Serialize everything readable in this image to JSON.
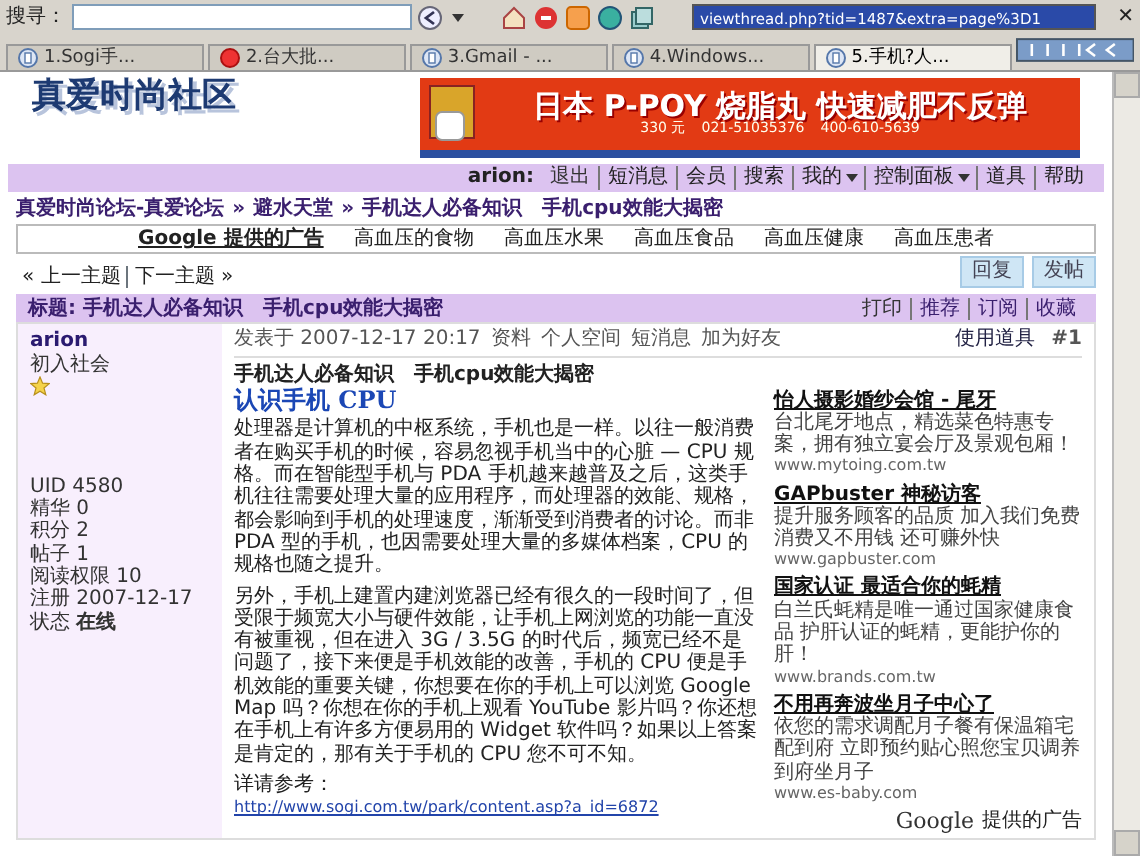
{
  "browser": {
    "search_label": "搜寻：",
    "address": "viewthread.php?tid=1487&extra=page%3D1",
    "close": "✕"
  },
  "tabs": [
    {
      "label": "1.Sogi手...",
      "selected": false,
      "kind": "page"
    },
    {
      "label": "2.台大批...",
      "selected": false,
      "kind": "error"
    },
    {
      "label": "3.Gmail - ...",
      "selected": false,
      "kind": "page"
    },
    {
      "label": "4.Windows...",
      "selected": false,
      "kind": "page"
    },
    {
      "label": "5.手机?人...",
      "selected": true,
      "kind": "page"
    }
  ],
  "site": {
    "logo": "真爱时尚社区",
    "banner": {
      "headline": "日本 P-POY 烧脂丸 快速减肥不反弹",
      "price": "330 元",
      "phones": [
        "021-51035376",
        "400-610-5639"
      ]
    }
  },
  "user_nav": {
    "user": "arion:",
    "links": [
      {
        "label": "退出",
        "dropdown": false
      },
      {
        "label": "短消息",
        "dropdown": false
      },
      {
        "label": "会员",
        "dropdown": false
      },
      {
        "label": "搜索",
        "dropdown": false
      },
      {
        "label": "我的",
        "dropdown": true
      },
      {
        "label": "控制面板",
        "dropdown": true
      },
      {
        "label": "道具",
        "dropdown": false
      },
      {
        "label": "帮助",
        "dropdown": false
      }
    ]
  },
  "breadcrumb": {
    "separator": "»",
    "items": [
      "真爱时尚论坛-真爱论坛",
      "避水天堂",
      "手机达人必备知识　手机cpu效能大揭密"
    ]
  },
  "ad_links": {
    "label": "Google 提供的广告",
    "links": [
      "高血压的食物",
      "高血压水果",
      "高血压食品",
      "高血压健康",
      "高血压患者"
    ]
  },
  "thread_nav": [
    "« 上一主题",
    "下一主题 »"
  ],
  "buttons": [
    "回复",
    "发帖"
  ],
  "thread_title": {
    "label": "标题:",
    "text": "手机达人必备知识　手机cpu效能大揭密"
  },
  "thread_actions": [
    "打印",
    "推荐",
    "订阅",
    "收藏"
  ],
  "post": {
    "author": {
      "name": "arion",
      "rank": "初入社会",
      "stats": [
        {
          "key": "UID",
          "value": "4580",
          "bold": false
        },
        {
          "key": "精华",
          "value": "0",
          "bold": false
        },
        {
          "key": "积分",
          "value": "2",
          "bold": false
        },
        {
          "key": "帖子",
          "value": "1",
          "bold": false
        },
        {
          "key": "阅读权限",
          "value": "10",
          "bold": false
        },
        {
          "key": "注册",
          "value": "2007-12-17",
          "bold": false
        },
        {
          "key": "状态",
          "value": "在线",
          "bold": true
        }
      ]
    },
    "meta": {
      "posted": "发表于 2007-12-17 20:17",
      "links": [
        "资料",
        "个人空间",
        "短消息",
        "加为好友"
      ],
      "tools": "使用道具",
      "floor": "#1"
    },
    "subtitle": "手机达人必备知识　手机cpu效能大揭密",
    "heading": "认识手机 CPU",
    "paragraphs": [
      "处理器是计算机的中枢系统，手机也是一样。以往一般消费者在购买手机的时候，容易忽视手机当中的心脏 — CPU 规格。而在智能型手机与 PDA 手机越来越普及之后，这类手机往往需要处理大量的应用程序，而处理器的效能、规格，都会影响到手机的处理速度，渐渐受到消费者的讨论。而非 PDA 型的手机，也因需要处理大量的多媒体档案，CPU 的规格也随之提升。",
      "另外，手机上建置内建浏览器已经有很久的一段时间了，但受限于频宽大小与硬件效能，让手机上网浏览的功能一直没有被重视，但在进入 3G / 3.5G 的时代后，频宽已经不是问题了，接下来便是手机效能的改善，手机的 CPU 便是手机效能的重要关键，你想要在你的手机上可以浏览 Google Map 吗？你想在你的手机上观看 YouTube 影片吗？你还想在手机上有许多方便易用的 Widget 软件吗？如果以上答案是肯定的，那有关于手机的 CPU 您不可不知。"
    ],
    "ref_label": "详请参考：",
    "ref_link": "http://www.sogi.com.tw/park/content.asp?a_id=6872"
  },
  "sponsored": {
    "ads": [
      {
        "title": "怡人摄影婚纱会馆 - 尾牙",
        "text": "台北尾牙地点，精选菜色特惠专案，拥有独立宴会厅及景观包厢！",
        "url": "www.mytoing.com.tw"
      },
      {
        "title": "GAPbuster 神秘访客",
        "text": "提升服务顾客的品质 加入我们免费消费又不用钱 还可赚外快",
        "url": "www.gapbuster.com"
      },
      {
        "title": "国家认证 最适合你的蚝精",
        "text": "白兰氏蚝精是唯一通过国家健康食品 护肝认证的蚝精，更能护你的肝！",
        "url": "www.brands.com.tw"
      },
      {
        "title": "不用再奔波坐月子中心了",
        "text": "依您的需求调配月子餐有保温箱宅配到府 立即预约贴心照您宝贝调养到府坐月子",
        "url": "www.es-baby.com"
      }
    ],
    "footer_logo": "Google",
    "footer_label": "提供的广告"
  }
}
